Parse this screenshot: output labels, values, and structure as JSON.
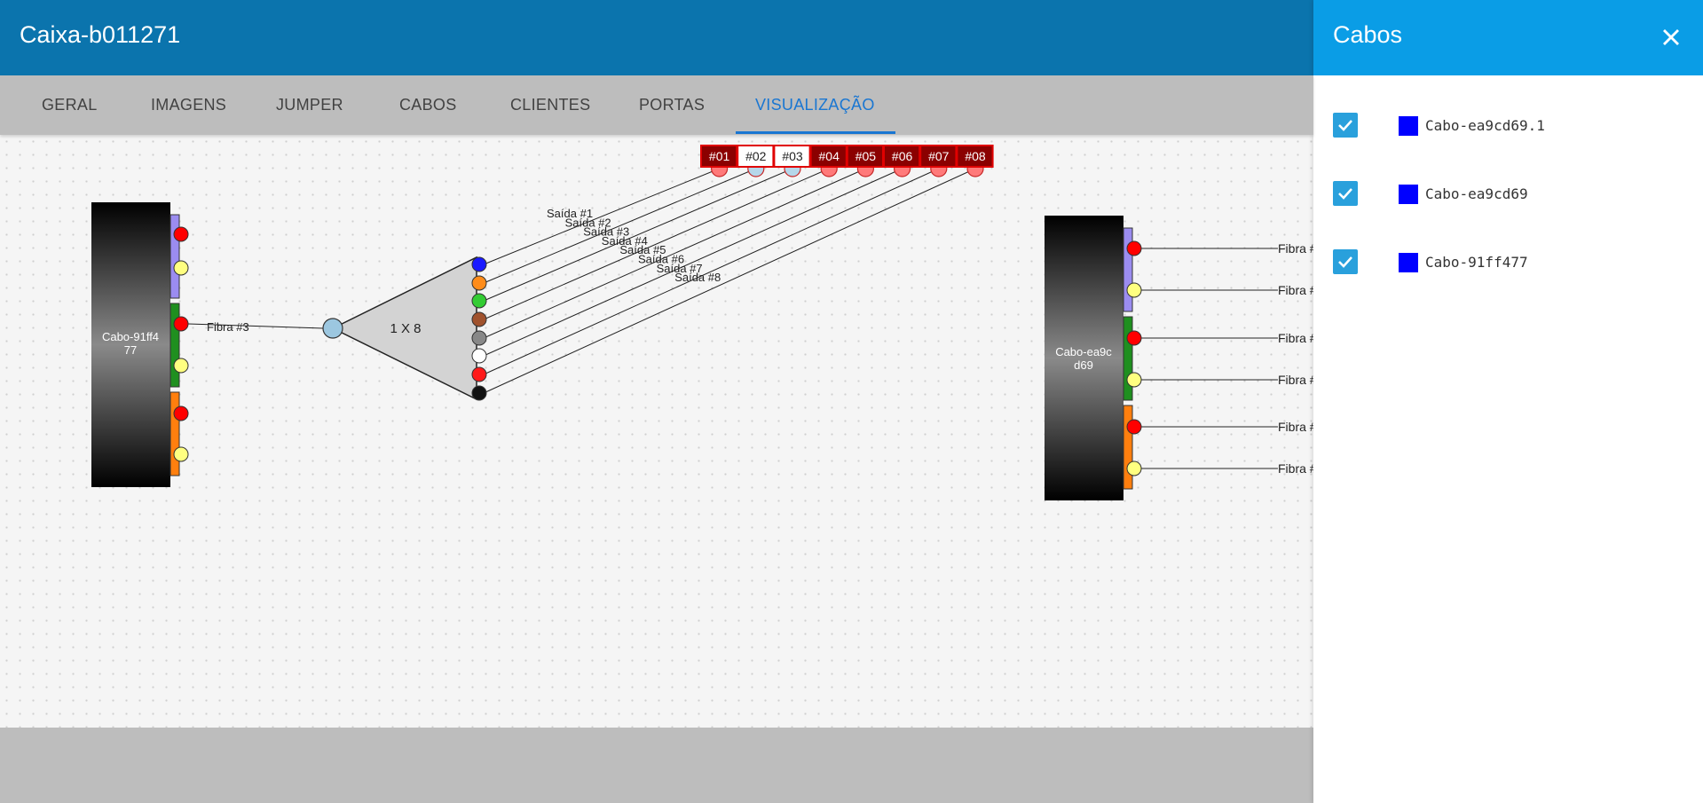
{
  "header": {
    "title": "Caixa-b011271"
  },
  "tabs": [
    {
      "label": "GERAL"
    },
    {
      "label": "IMAGENS"
    },
    {
      "label": "JUMPER"
    },
    {
      "label": "CABOS"
    },
    {
      "label": "CLIENTES"
    },
    {
      "label": "PORTAS"
    },
    {
      "label": "VISUALIZAÇÃO",
      "active": true
    }
  ],
  "diagram": {
    "left_cable": {
      "label_line1": "Cabo-91ff4",
      "label_line2": "77"
    },
    "right_cable": {
      "label_line1": "Cabo-ea9c",
      "label_line2": "d69"
    },
    "input_fiber_label": "Fibra #3",
    "splitter_label": "1 X 8",
    "output_labels": [
      "Saída #1",
      "Saída #2",
      "Saída #3",
      "Saída #4",
      "Saída #5",
      "Saída #6",
      "Saída #7",
      "Saída #8"
    ],
    "port_tags": [
      {
        "label": "#01",
        "occupied": true
      },
      {
        "label": "#02",
        "occupied": false
      },
      {
        "label": "#03",
        "occupied": false
      },
      {
        "label": "#04",
        "occupied": true
      },
      {
        "label": "#05",
        "occupied": true
      },
      {
        "label": "#06",
        "occupied": true
      },
      {
        "label": "#07",
        "occupied": true
      },
      {
        "label": "#08",
        "occupied": true
      }
    ],
    "right_fiber_labels": [
      "Fibra #",
      "Fibra #",
      "Fibra #",
      "Fibra #",
      "Fibra #",
      "Fibra #"
    ],
    "output_port_colors": [
      "#1a1aff",
      "#ff8c1a",
      "#33cc33",
      "#a0522d",
      "#888888",
      "#ffffff",
      "#ff1a1a",
      "#111111"
    ],
    "tube_colors": [
      "#9b8cf0",
      "#1f8f1f",
      "#ff7f0e"
    ]
  },
  "panel": {
    "title": "Cabos",
    "cables": [
      {
        "label": "Cabo-ea9cd69.1",
        "checked": true,
        "color": "#0000ff"
      },
      {
        "label": "Cabo-ea9cd69",
        "checked": true,
        "color": "#0000ff"
      },
      {
        "label": "Cabo-91ff477",
        "checked": true,
        "color": "#0000ff"
      }
    ]
  }
}
